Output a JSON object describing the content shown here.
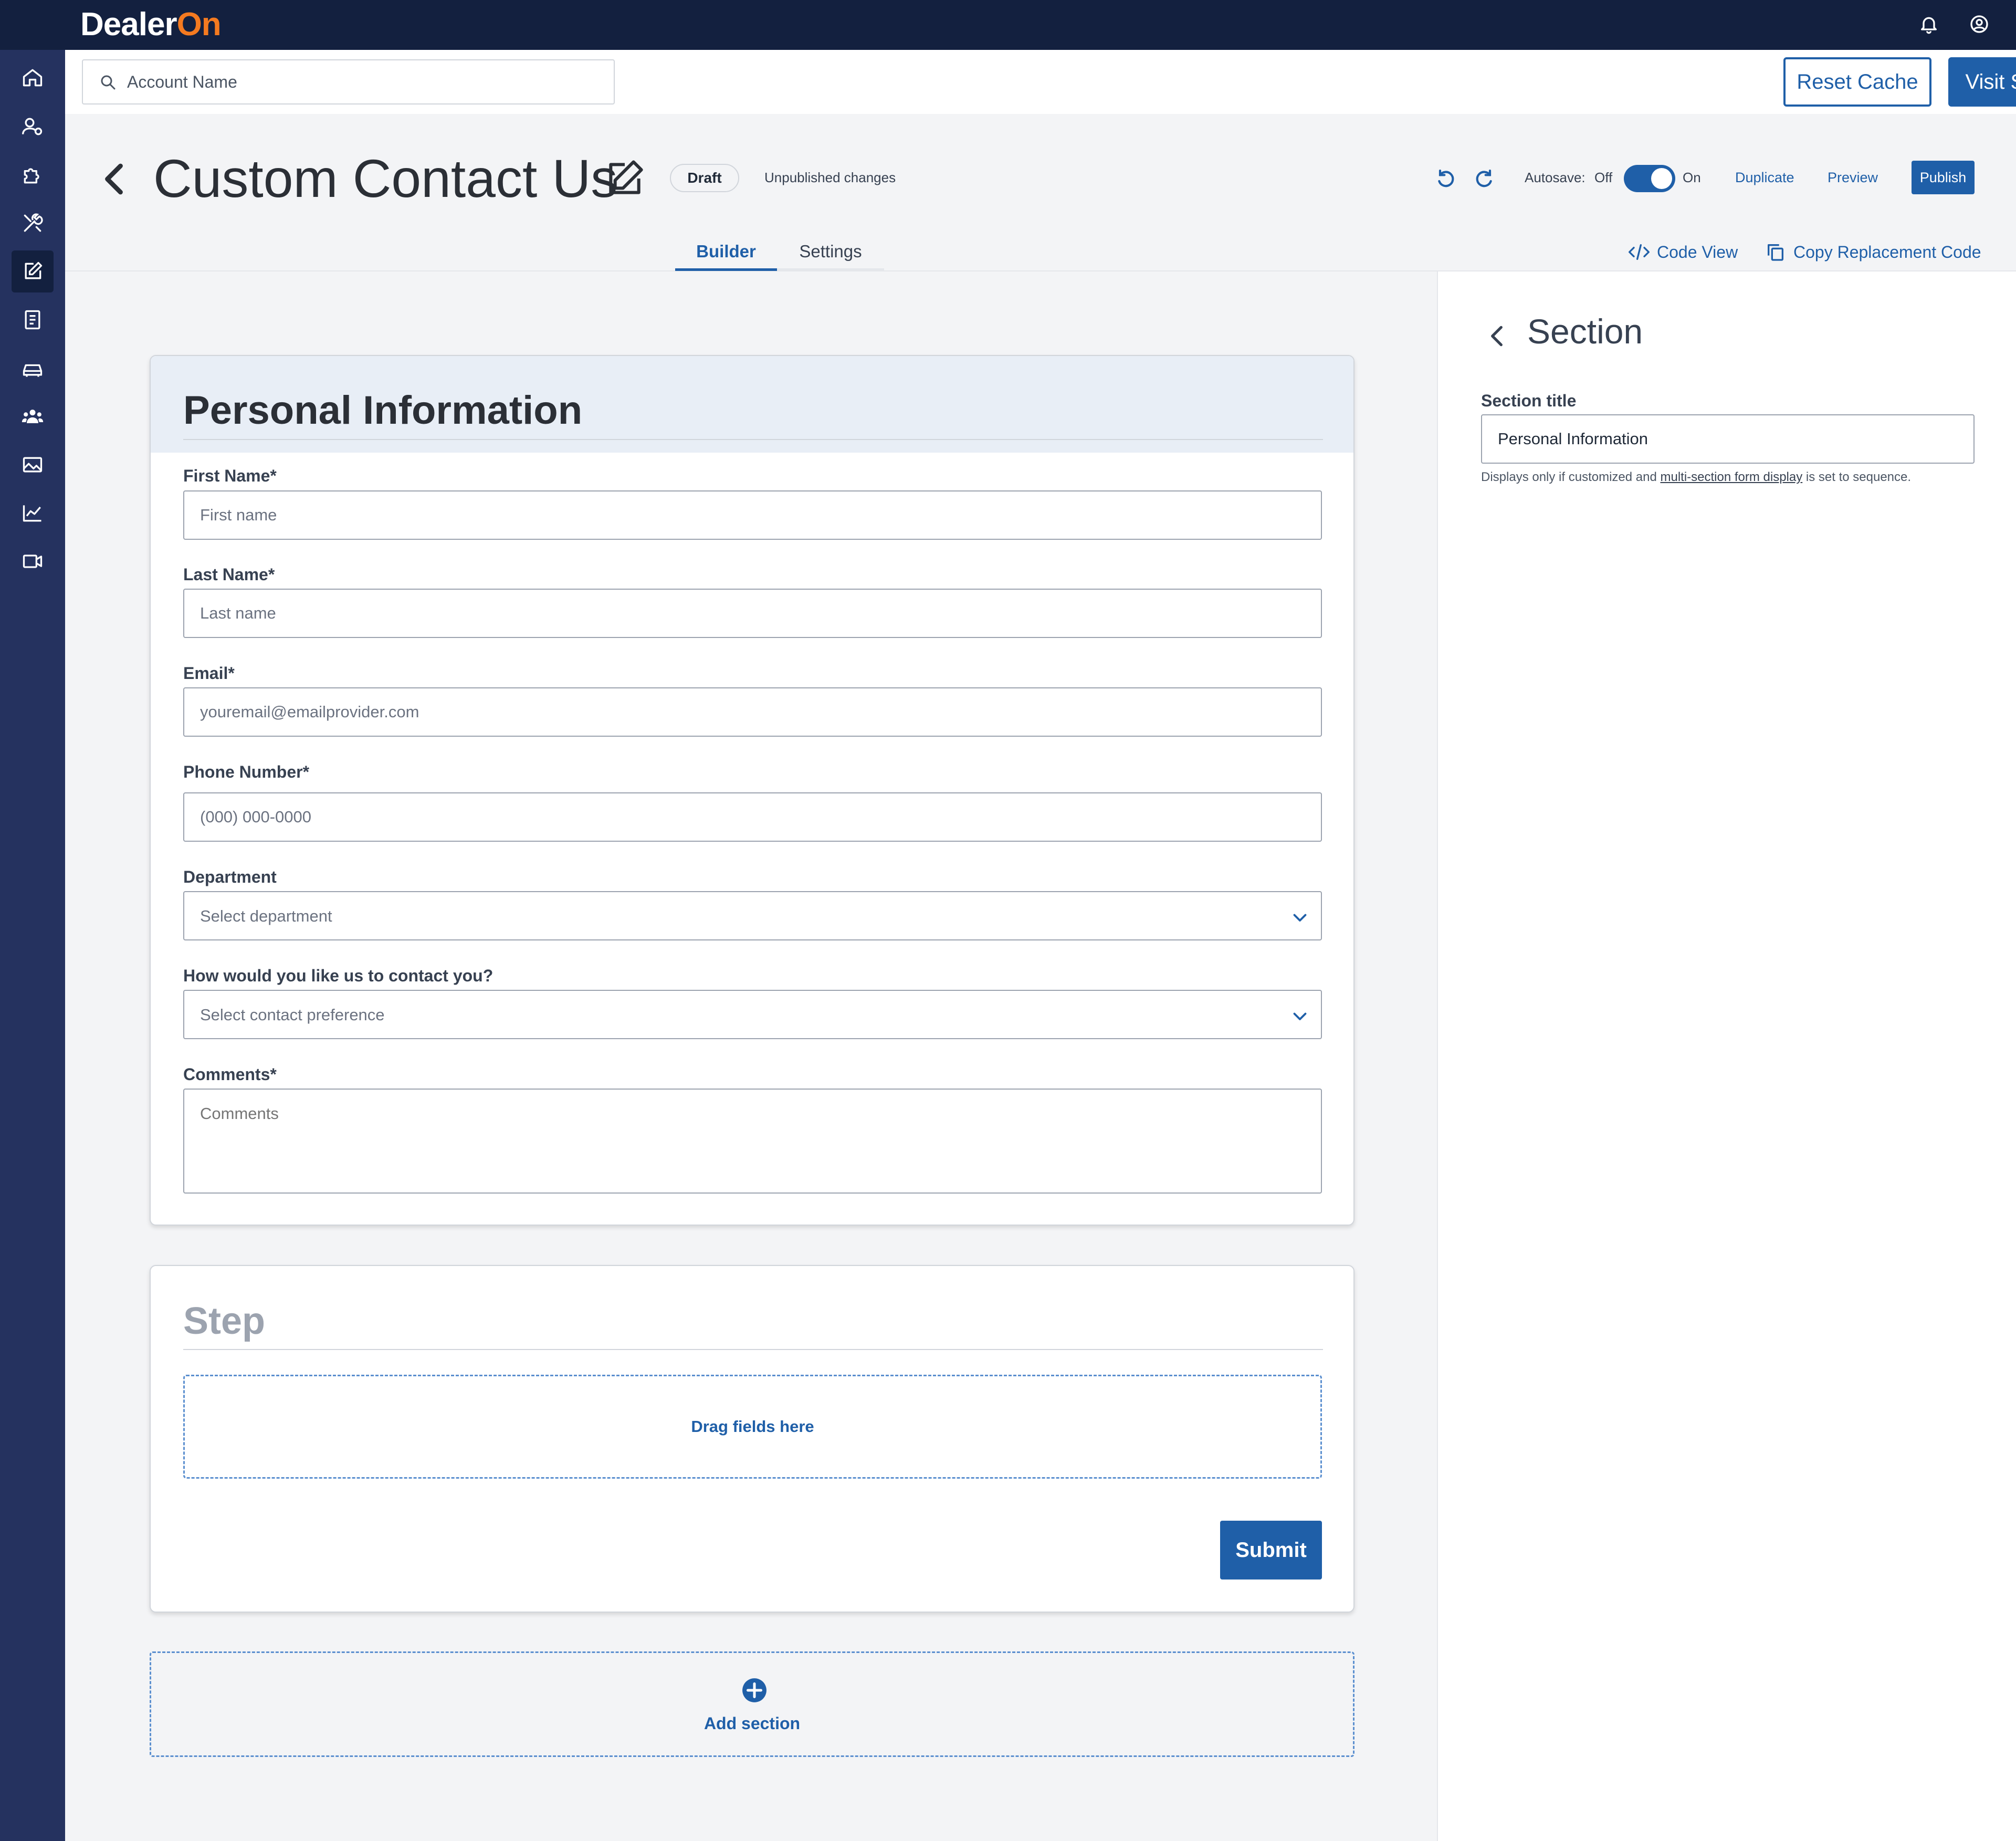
{
  "brand": {
    "logo_main": "Dealer",
    "logo_accent": "On",
    "accent_color": "#f47a20",
    "primary_color": "#1f5fa8",
    "nav_color": "#13203f"
  },
  "topbar": {
    "icons": [
      "bell-icon",
      "user-circle-icon"
    ]
  },
  "sidebar": {
    "items": [
      "expand-icon",
      "home-icon",
      "user-settings-icon",
      "puzzle-icon",
      "tools-icon",
      "edit-icon",
      "document-icon",
      "car-icon",
      "users-icon",
      "image-icon",
      "chart-icon",
      "video-icon"
    ],
    "active": "edit-icon"
  },
  "search": {
    "placeholder": "Account Name",
    "value": ""
  },
  "actions": {
    "reset_cache": "Reset Cache",
    "visit_site": "Visit Site"
  },
  "header": {
    "title": "Custom Contact Us",
    "status": "Draft",
    "unpublished": "Unpublished changes",
    "autosave_label": "Autosave:",
    "autosave_off": "Off",
    "autosave_on": "On",
    "autosave_enabled": true,
    "duplicate": "Duplicate",
    "preview": "Preview",
    "publish": "Publish"
  },
  "tabs": {
    "builder": "Builder",
    "settings": "Settings",
    "active": "Builder"
  },
  "tools": {
    "code_view": "Code View",
    "copy_code": "Copy Replacement Code"
  },
  "form": {
    "section_title": "Personal Information",
    "fields": {
      "first_name": {
        "label": "First Name*",
        "placeholder": "First name"
      },
      "last_name": {
        "label": "Last Name*",
        "placeholder": "Last name"
      },
      "email": {
        "label": "Email*",
        "placeholder": "youremail@emailprovider.com"
      },
      "phone": {
        "label": "Phone Number*",
        "placeholder": "(000) 000-0000"
      },
      "department": {
        "label": "Department",
        "placeholder": "Select department"
      },
      "contact": {
        "label": "How would you like us to contact you?",
        "placeholder": "Select contact preference"
      },
      "comments": {
        "label": "Comments*",
        "placeholder": "Comments"
      }
    },
    "step_title": "Step",
    "drag_text": "Drag fields here",
    "submit": "Submit",
    "add_section": "Add section"
  },
  "panel": {
    "title": "Section",
    "label": "Section title",
    "value": "Personal Information",
    "help_pre": "Displays only if customized and ",
    "help_link": "multi-section form display",
    "help_post": " is set to sequence."
  }
}
